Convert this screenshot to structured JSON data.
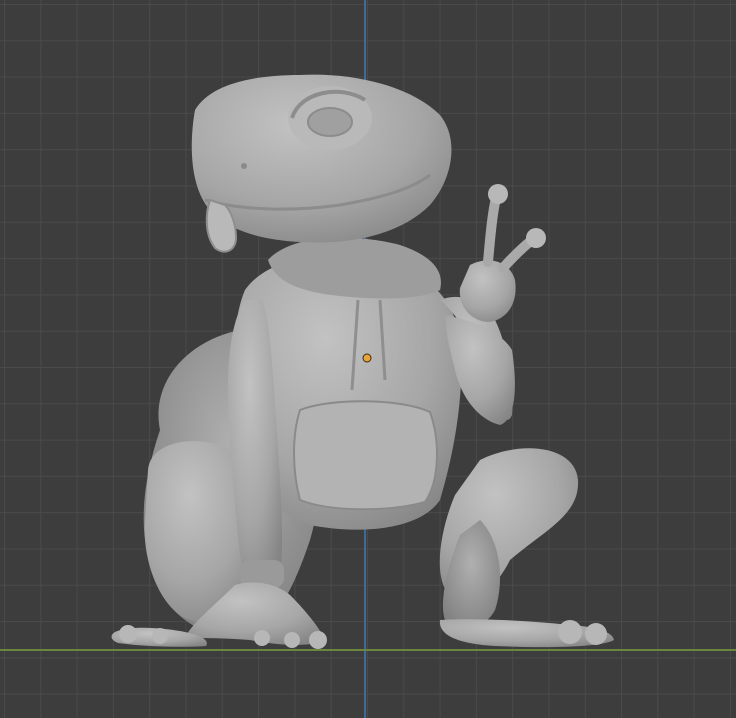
{
  "viewport": {
    "background_color": "#3d3d3d",
    "grid_color": "#4a4a4a",
    "z_axis_color": "#3f6fa6",
    "ground_axis_color": "#6e8a3e",
    "model_color": "#a7a7a7",
    "object_origin_color": "#e8a33a"
  },
  "model": {
    "icon": "sculpt-mesh-icon"
  }
}
